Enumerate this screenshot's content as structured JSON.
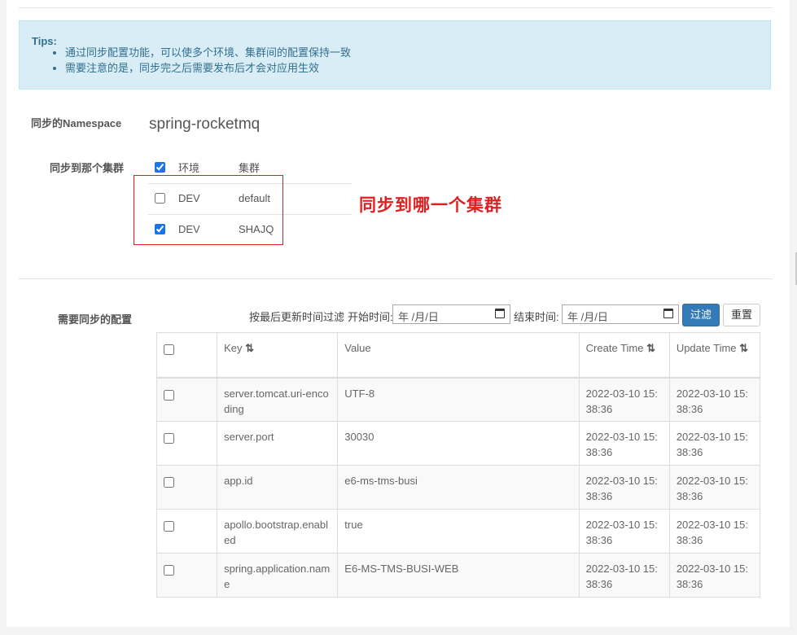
{
  "tips": {
    "title": "Tips:",
    "items": [
      "通过同步配置功能，可以使多个环境、集群间的配置保持一致",
      "需要注意的是，同步完之后需要发布后才会对应用生效"
    ]
  },
  "namespace": {
    "label": "同步的Namespace",
    "value": "spring-rocketmq"
  },
  "cluster_select": {
    "label": "同步到那个集群",
    "header": {
      "env": "环境",
      "cluster": "集群",
      "checked": true
    },
    "rows": [
      {
        "env": "DEV",
        "cluster": "default",
        "checked": false
      },
      {
        "env": "DEV",
        "cluster": "SHAJQ",
        "checked": true
      }
    ],
    "annotation": "同步到哪一个集群",
    "annotation_color": "#e02020"
  },
  "configs": {
    "label": "需要同步的配置",
    "filter": {
      "label": "按最后更新时间过滤",
      "start_label": "开始时间:",
      "start_placeholder": "年 /月/日",
      "end_label": "结束时间:",
      "end_placeholder": "年 /月/日",
      "filter_button": "过滤",
      "reset_button": "重置"
    },
    "columns": [
      "Key",
      "Value",
      "Create Time",
      "Update Time"
    ],
    "sort_glyph": "⇅",
    "rows": [
      {
        "key": "server.tomcat.uri-encoding",
        "value": "UTF-8",
        "create": "2022-03-10 15:38:36",
        "update": "2022-03-10 15:38:36"
      },
      {
        "key": "server.port",
        "value": "30030",
        "create": "2022-03-10 15:38:36",
        "update": "2022-03-10 15:38:36"
      },
      {
        "key": "app.id",
        "value": "e6-ms-tms-busi",
        "create": "2022-03-10 15:38:36",
        "update": "2022-03-10 15:38:36"
      },
      {
        "key": "apollo.bootstrap.enabled",
        "value": "true",
        "create": "2022-03-10 15:38:36",
        "update": "2022-03-10 15:38:36"
      },
      {
        "key": "spring.application.name",
        "value": "E6-MS-TMS-BUSI-WEB",
        "create": "2022-03-10 15:38:36",
        "update": "2022-03-10 15:38:36"
      }
    ]
  },
  "colors": {
    "primary": "#337ab7",
    "tips_bg": "#d9edf7",
    "tips_text": "#31708f"
  }
}
